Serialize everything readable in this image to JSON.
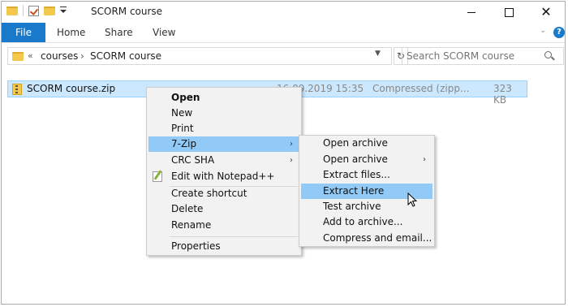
{
  "window": {
    "title": "SCORM course",
    "tabs": {
      "file": "File",
      "home": "Home",
      "share": "Share",
      "view": "View"
    },
    "help": "?"
  },
  "address": {
    "prefix": "«",
    "crumbs": [
      "courses",
      "SCORM course"
    ],
    "separator": "›"
  },
  "search": {
    "placeholder": "Search SCORM course"
  },
  "file_row": {
    "name": "SCORM course.zip",
    "date": "16.09.2019 15:35",
    "type": "Compressed (zipp...",
    "size": "323 KB"
  },
  "context_menu": {
    "items": [
      {
        "label": "Open"
      },
      {
        "label": "New"
      },
      {
        "label": "Print"
      },
      {
        "label": "7-Zip"
      },
      {
        "label": "CRC SHA"
      },
      {
        "label": "Edit with Notepad++"
      },
      {
        "label": "Create shortcut"
      },
      {
        "label": "Delete"
      },
      {
        "label": "Rename"
      },
      {
        "label": "Properties"
      }
    ]
  },
  "submenu": {
    "items": [
      {
        "label": "Open archive"
      },
      {
        "label": "Open archive"
      },
      {
        "label": "Extract files..."
      },
      {
        "label": "Extract Here"
      },
      {
        "label": "Test archive"
      },
      {
        "label": "Add to archive..."
      },
      {
        "label": "Compress and email..."
      }
    ]
  },
  "colors": {
    "accent": "#1979ca",
    "selection": "#cce8ff",
    "menu_highlight": "#91c9f7"
  },
  "icons": [
    "folder-icon",
    "properties-check-icon",
    "zip-file-icon",
    "notepad-icon",
    "search-icon",
    "refresh-icon",
    "help-icon"
  ]
}
